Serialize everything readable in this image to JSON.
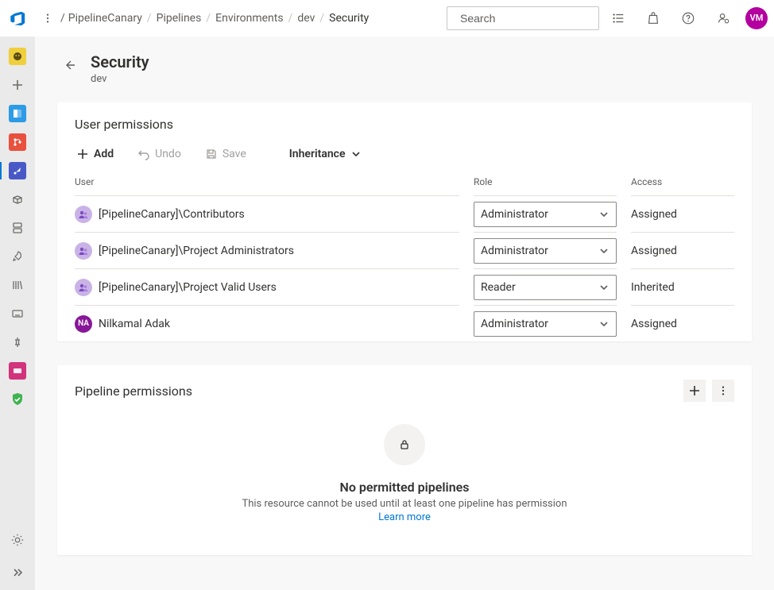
{
  "header": {
    "breadcrumbs": [
      "PipelineCanary",
      "Pipelines",
      "Environments",
      "dev",
      "Security"
    ],
    "search_placeholder": "Search",
    "user_initials": "VM"
  },
  "page": {
    "title": "Security",
    "subtitle": "dev"
  },
  "commandbar": {
    "add": "Add",
    "undo": "Undo",
    "save": "Save",
    "inheritance": "Inheritance"
  },
  "user_permissions": {
    "title": "User permissions",
    "columns": {
      "user": "User",
      "role": "Role",
      "access": "Access"
    },
    "rows": [
      {
        "name": "[PipelineCanary]\\Contributors",
        "type": "group",
        "role": "Administrator",
        "access": "Assigned"
      },
      {
        "name": "[PipelineCanary]\\Project Administrators",
        "type": "group",
        "role": "Administrator",
        "access": "Assigned"
      },
      {
        "name": "[PipelineCanary]\\Project Valid Users",
        "type": "group",
        "role": "Reader",
        "access": "Inherited"
      },
      {
        "name": "Nilkamal Adak",
        "type": "person",
        "initials": "NA",
        "role": "Administrator",
        "access": "Assigned"
      }
    ]
  },
  "pipeline_permissions": {
    "title": "Pipeline permissions",
    "empty_title": "No permitted pipelines",
    "empty_desc": "This resource cannot be used until at least one pipeline has permission",
    "learn_more": "Learn more"
  },
  "sidebar": {
    "items": [
      {
        "id": "project-avatar"
      },
      {
        "id": "new"
      },
      {
        "id": "boards"
      },
      {
        "id": "repos"
      },
      {
        "id": "pipelines",
        "selected": true
      },
      {
        "id": "artifacts"
      },
      {
        "id": "testplans"
      },
      {
        "id": "rocket"
      },
      {
        "id": "library"
      },
      {
        "id": "keyboard"
      },
      {
        "id": "variable"
      },
      {
        "id": "deploys"
      },
      {
        "id": "compliance"
      }
    ]
  }
}
